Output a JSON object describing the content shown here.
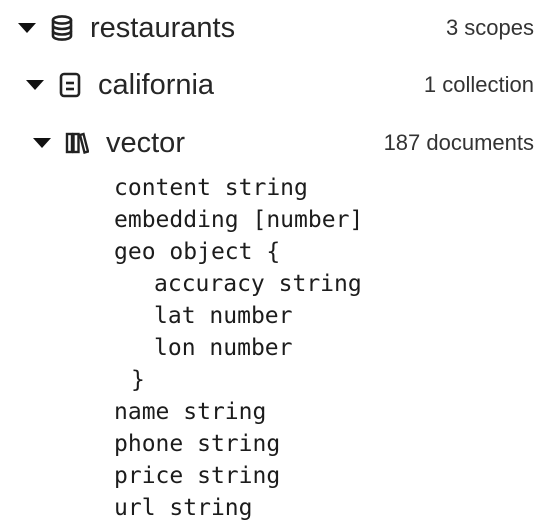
{
  "tree": {
    "database": {
      "label": "restaurants",
      "count": "3 scopes",
      "icon": "database-icon",
      "expanded": true
    },
    "scope": {
      "label": "california",
      "count": "1 collection",
      "icon": "scope-icon",
      "expanded": true
    },
    "collection": {
      "label": "vector",
      "count": "187 documents",
      "icon": "collection-icon",
      "expanded": true
    }
  },
  "schema": {
    "fields": [
      {
        "name": "content",
        "type": "string"
      },
      {
        "name": "embedding",
        "type": "[number]"
      },
      {
        "name": "geo",
        "type": "object {"
      },
      {
        "name": "accuracy",
        "type": "string"
      },
      {
        "name": "lat",
        "type": "number"
      },
      {
        "name": "lon",
        "type": "number"
      },
      {
        "close": "}"
      },
      {
        "name": "name",
        "type": "string"
      },
      {
        "name": "phone",
        "type": "string"
      },
      {
        "name": "price",
        "type": "string"
      },
      {
        "name": "url",
        "type": "string"
      }
    ]
  }
}
